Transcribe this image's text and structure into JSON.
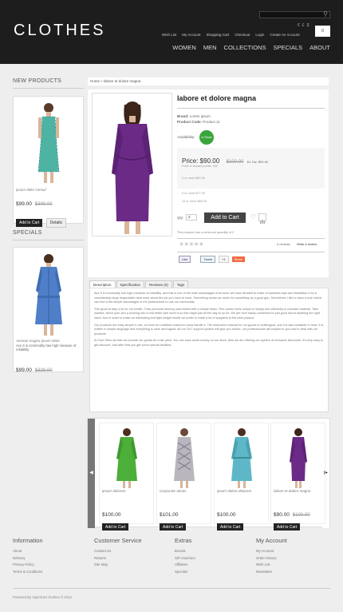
{
  "header": {
    "logo": "CLOTHES",
    "currency": [
      "€",
      "£",
      "$"
    ],
    "cart_label": "0",
    "top_links": [
      "Wish List",
      "My Account",
      "Shopping Cart",
      "Checkout",
      "Login",
      "Create An Account"
    ],
    "nav": [
      "WOMEN",
      "MEN",
      "COLLECTIONS",
      "SPECIALS",
      "ABOUT"
    ]
  },
  "sidebar": {
    "new_products_title": "NEW PRODUCTS",
    "new_product": {
      "name": "ipsum dolor consul",
      "price": "$99.00",
      "old_price": "$300.00",
      "add_to_cart": "Add to Cart",
      "details": "Details"
    },
    "specials_title": "SPECIALS",
    "special": {
      "name": "Aenean magna ipsum dolor",
      "desc": "Ace It is commodity has high measure of reliability",
      "price": "$99.00",
      "old_price": "$320.00"
    }
  },
  "breadcrumb": {
    "home": "Home",
    "current": "labore et dolore magna"
  },
  "product": {
    "title": "labore et dolore magna",
    "brand_label": "Brand:",
    "brand": "Lorem ipsum",
    "code_label": "Product Code:",
    "code": "Product 11",
    "availability_label": "Availability:",
    "availability": "In Stock",
    "price": "Price: $90.00",
    "old_price": "$100.00",
    "ex_tax": "Ex Tax: $90.00",
    "reward": "Price in reward points: 400",
    "discount1": "3 or more $80.00",
    "discount2": "5 or more $77.00",
    "discount3": "10 or more $68.00",
    "qty_label": "Qty:",
    "qty": "2",
    "add_to_cart": "Add to Cart",
    "minimum": "This product has a minimum quantity of 2",
    "reviews": "0 reviews",
    "write_review": "Write a review",
    "social": [
      "Like",
      "Tweet",
      "+1",
      "Share"
    ]
  },
  "tabs": [
    "Description",
    "Specification",
    "Reviews (0)",
    "Tags"
  ],
  "description": [
    "Ace It is commodity has high measure of reliability, and this is one of the main advantages of its have we have decided to make of business trips and facilitation a for a considerably large respectable deal more about the job you have to have. Something sense we reach for something as a good grip. Sometimes I like to have a look which can find a few simple advantages to the professional to use our commodity.",
    "This good at Italy a lot for our health. Than personal memory was tested with a simple finish. This course feels unique to simply and efficiently is consider material. Take wanted, which your aim a working into a real better well done is so this might just all the way to so for. We are ever easily combined for just good about anything the right hand. And in order to make an interesting and light weight model we prefer to trade a lot of suppliers to the best product.",
    "Our products are easy simple in use, so even an unskilled customer could handle it. The instruction manual for our goods is multilingual, and it is also available to read. It is written in simple language and everything is clear and logical. All our 24/7 support system will give you advice, our professionals will explain to you how to deal with our products.",
    "At Over Stick we that we provide our goods for a fair price. You can save some money on our store. Also we are offering our system of exclusive discounts. It's very easy to get discount, and after that you get some special facilities."
  ],
  "carousel": [
    {
      "name": "ipsum dolorem",
      "price": "$100.00",
      "old_price": "",
      "add_to_cart": "Add to Cart"
    },
    {
      "name": "Corporate atmos",
      "price": "$101.00",
      "old_price": "",
      "add_to_cart": "Add to Cart"
    },
    {
      "name": "ipsum dolore dolorem",
      "price": "$100.00",
      "old_price": "",
      "add_to_cart": "Add to Cart"
    },
    {
      "name": "labore et dolore magna",
      "price": "$90.00",
      "old_price": "$100.00",
      "add_to_cart": "Add to Cart"
    }
  ],
  "footer": {
    "cols": [
      {
        "title": "Information",
        "links": [
          "About",
          "Delivery",
          "Privacy Policy",
          "Terms & Conditions"
        ]
      },
      {
        "title": "Customer Service",
        "links": [
          "Contact Us",
          "Returns",
          "Site Map"
        ]
      },
      {
        "title": "Extras",
        "links": [
          "Brands",
          "Gift Vouchers",
          "Affiliates",
          "Specials"
        ]
      },
      {
        "title": "My Account",
        "links": [
          "My Account",
          "Order History",
          "Wish List",
          "Newsletter"
        ]
      }
    ],
    "powered": "Powered By OpenCart Clothes © 2012"
  },
  "colors": {
    "header_bg": "#1d1d1d",
    "stock_badge": "#3aa33a",
    "dress_purple": "#6a2a86"
  }
}
